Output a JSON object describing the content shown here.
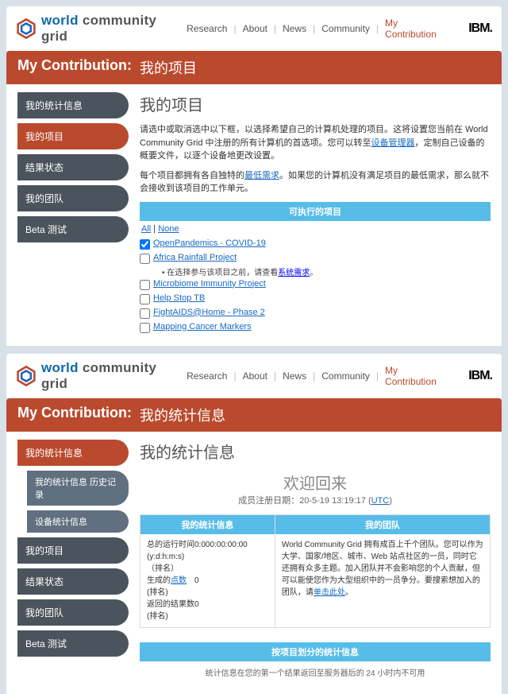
{
  "logo_words": [
    "world",
    "community",
    "grid"
  ],
  "nav": {
    "items": [
      "Research",
      "About",
      "News",
      "Community",
      "My Contribution"
    ],
    "active_index": 4,
    "ibm": "IBM."
  },
  "top": {
    "title_prefix": "My Contribution:",
    "title": "我的项目",
    "sidebar": [
      {
        "label": "我的统计信息",
        "active": false
      },
      {
        "label": "我的项目",
        "active": true
      },
      {
        "label": "结果状态",
        "active": false
      },
      {
        "label": "我的团队",
        "active": false
      },
      {
        "label": "Beta 测试",
        "active": false
      }
    ],
    "heading": "我的项目",
    "para1_a": "请选中或取消选中以下框，以选择希望自己的计算机处理的项目。这将设置您当前在 World Community Grid 中注册的所有计算机的首选项。您可以转至",
    "para1_link": "设备管理器",
    "para1_b": "，定制自己设备的概要文件，以逐个设备地更改设置。",
    "para2_a": "每个项目都拥有各自独特的",
    "para2_link": "最低需求",
    "para2_b": "。如果您的计算机没有满足项目的最低需求，那么就不会接收到该项目的工作单元。",
    "bar": "可执行的项目",
    "filter_all": "All",
    "filter_none": "None",
    "projects": [
      {
        "name": "OpenPandemics - COVID-19",
        "checked": true
      },
      {
        "name": "Africa Rainfall Project",
        "checked": false,
        "note_a": "• 在选择参与该项目之前，请查看",
        "note_link": "系统需求",
        "note_b": "。"
      },
      {
        "name": "Microbiome Immunity Project",
        "checked": false
      },
      {
        "name": "Help Stop TB",
        "checked": false
      },
      {
        "name": "FightAIDS@Home - Phase 2",
        "checked": false
      },
      {
        "name": "Mapping Cancer Markers",
        "checked": false
      }
    ]
  },
  "bottom": {
    "title_prefix": "My Contribution:",
    "title": "我的统计信息",
    "sidebar": [
      {
        "label": "我的统计信息",
        "active": true
      },
      {
        "label": "我的统计信息 历史记录",
        "sub": true
      },
      {
        "label": "设备统计信息",
        "sub": true
      },
      {
        "label": "我的项目"
      },
      {
        "label": "结果状态"
      },
      {
        "label": "我的团队"
      },
      {
        "label": "Beta 测试"
      }
    ],
    "heading": "我的统计信息",
    "welcome": "欢迎回来",
    "reg_prefix": "成员注册日期：",
    "reg_date": "20-5-19 13:19:17 (",
    "reg_utc": "UTC",
    "reg_suffix": ")",
    "col1_hdr": "我的统计信息",
    "col2_hdr": "我的团队",
    "stat_rows": [
      {
        "label": "总的运行时间 (y:d:h:m:s)",
        "value": "0:000:00:00:00"
      },
      {
        "label": "（排名）"
      },
      {
        "label_a": "生成的",
        "label_link": "点数",
        "label_b": " (排名)",
        "value": "0"
      },
      {
        "label_a": "返回的结果数 (排名)",
        "value": "0"
      }
    ],
    "team_desc_a": "World Community Grid 拥有成百上千个团队。您可以作为大学、国家/地区、城市、Web 站点社区的一员，同时它还拥有众多主题。加入团队并不会影响您的个人贡献，但可以能使您作为大型组织中的一员争分。要搜索想加入的团队，请",
    "team_desc_link": "单击此处",
    "team_desc_b": "。",
    "bar2": "按项目划分的统计信息",
    "footer_fragment": "统计信息在您的第一个结果返回至服务器后的 24 小时内不可用"
  }
}
